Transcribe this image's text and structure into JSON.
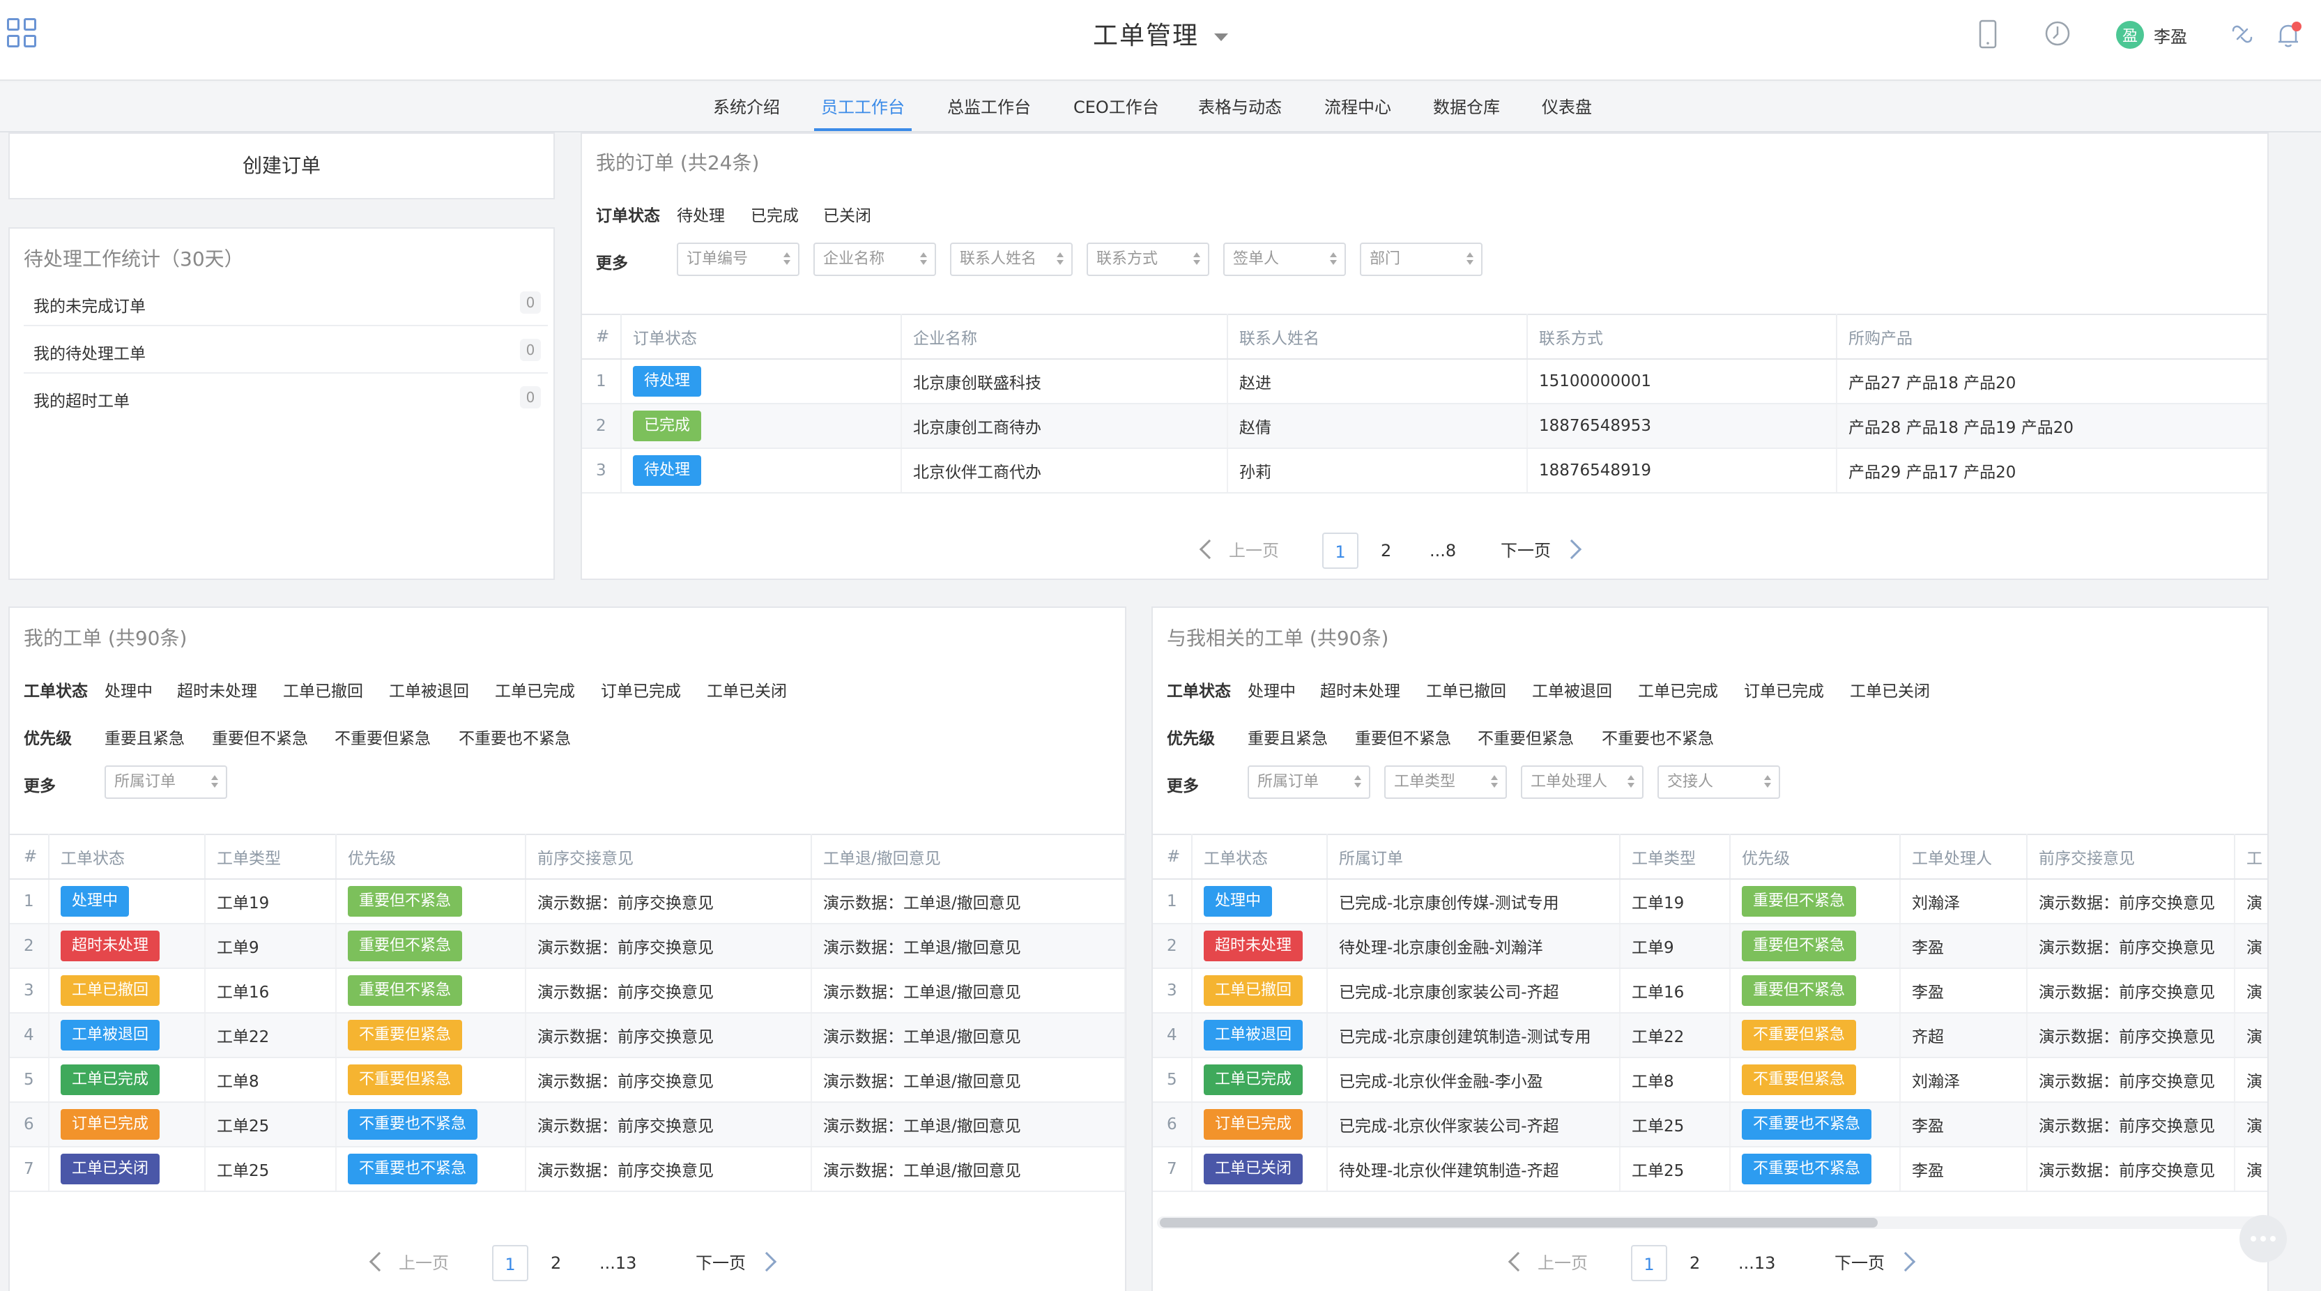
{
  "header": {
    "title": "工单管理",
    "user_name": "李盈",
    "user_initial": "盈",
    "icons": [
      "apps-grid-icon",
      "mobile-icon",
      "clock-icon",
      "link-icon",
      "bell-icon"
    ]
  },
  "nav": {
    "tabs": [
      {
        "label": "系统介绍"
      },
      {
        "label": "员工工作台",
        "active": true
      },
      {
        "label": "总监工作台"
      },
      {
        "label": "CEO工作台"
      },
      {
        "label": "表格与动态"
      },
      {
        "label": "流程中心"
      },
      {
        "label": "数据仓库"
      },
      {
        "label": "仪表盘"
      }
    ]
  },
  "create_order": {
    "label": "创建订单"
  },
  "pending_stats": {
    "title": "待处理工作统计（30天）",
    "rows": [
      {
        "label": "我的未完成订单",
        "count": "0"
      },
      {
        "label": "我的待处理工单",
        "count": "0"
      },
      {
        "label": "我的超时工单",
        "count": "0"
      }
    ]
  },
  "my_orders": {
    "title": "我的订单 (共24条)",
    "status_label": "订单状态",
    "status_options": [
      "待处理",
      "已完成",
      "已关闭"
    ],
    "more_label": "更多",
    "filters": [
      "订单编号",
      "企业名称",
      "联系人姓名",
      "联系方式",
      "签单人",
      "部门"
    ],
    "columns": [
      "#",
      "订单状态",
      "企业名称",
      "联系人姓名",
      "联系方式",
      "所购产品"
    ],
    "rows": [
      {
        "idx": "1",
        "status": "待处理",
        "status_color": "#2d9cf0",
        "company": "北京康创联盛科技",
        "contact": "赵进",
        "phone": "15100000001",
        "products": "产品27 产品18 产品20"
      },
      {
        "idx": "2",
        "status": "已完成",
        "status_color": "#7cc05b",
        "company": "北京康创工商待办",
        "contact": "赵倩",
        "phone": "18876548953",
        "products": "产品28 产品18 产品19 产品20"
      },
      {
        "idx": "3",
        "status": "待处理",
        "status_color": "#2d9cf0",
        "company": "北京伙伴工商代办",
        "contact": "孙莉",
        "phone": "18876548919",
        "products": "产品29 产品17 产品20"
      }
    ],
    "pager": {
      "prev": "上一页",
      "pages": [
        "1",
        "2",
        "...8"
      ],
      "current": "1",
      "next": "下一页"
    }
  },
  "my_tickets": {
    "title": "我的工单 (共90条)",
    "status_label": "工单状态",
    "status_options": [
      "处理中",
      "超时未处理",
      "工单已撤回",
      "工单被退回",
      "工单已完成",
      "订单已完成",
      "工单已关闭"
    ],
    "priority_label": "优先级",
    "priority_options": [
      "重要且紧急",
      "重要但不紧急",
      "不重要但紧急",
      "不重要也不紧急"
    ],
    "more_label": "更多",
    "filters": [
      "所属订单"
    ],
    "columns": [
      "#",
      "工单状态",
      "工单类型",
      "优先级",
      "前序交接意见",
      "工单退/撤回意见"
    ],
    "rows": [
      {
        "idx": "1",
        "status": "处理中",
        "status_color": "#2d9cf0",
        "type": "工单19",
        "priority": "重要但不紧急",
        "priority_color": "#7cc05b",
        "handover": "演示数据：前序交换意见",
        "back": "演示数据：工单退/撤回意见"
      },
      {
        "idx": "2",
        "status": "超时未处理",
        "status_color": "#e5474b",
        "type": "工单9",
        "priority": "重要但不紧急",
        "priority_color": "#7cc05b",
        "handover": "演示数据：前序交换意见",
        "back": "演示数据：工单退/撤回意见"
      },
      {
        "idx": "3",
        "status": "工单已撤回",
        "status_color": "#f5b431",
        "type": "工单16",
        "priority": "重要但不紧急",
        "priority_color": "#7cc05b",
        "handover": "演示数据：前序交换意见",
        "back": "演示数据：工单退/撤回意见"
      },
      {
        "idx": "4",
        "status": "工单被退回",
        "status_color": "#2d9cf0",
        "type": "工单22",
        "priority": "不重要但紧急",
        "priority_color": "#f5b431",
        "handover": "演示数据：前序交换意见",
        "back": "演示数据：工单退/撤回意见"
      },
      {
        "idx": "5",
        "status": "工单已完成",
        "status_color": "#3fa95b",
        "type": "工单8",
        "priority": "不重要但紧急",
        "priority_color": "#f5b431",
        "handover": "演示数据：前序交换意见",
        "back": "演示数据：工单退/撤回意见"
      },
      {
        "idx": "6",
        "status": "订单已完成",
        "status_color": "#f2932b",
        "type": "工单25",
        "priority": "不重要也不紧急",
        "priority_color": "#2d9cf0",
        "handover": "演示数据：前序交换意见",
        "back": "演示数据：工单退/撤回意见"
      },
      {
        "idx": "7",
        "status": "工单已关闭",
        "status_color": "#4a57a8",
        "type": "工单25",
        "priority": "不重要也不紧急",
        "priority_color": "#2d9cf0",
        "handover": "演示数据：前序交换意见",
        "back": "演示数据：工单退/撤回意见"
      }
    ],
    "pager": {
      "prev": "上一页",
      "pages": [
        "1",
        "2",
        "...13"
      ],
      "current": "1",
      "next": "下一页"
    }
  },
  "related_tickets": {
    "title": "与我相关的工单 (共90条)",
    "status_label": "工单状态",
    "status_options": [
      "处理中",
      "超时未处理",
      "工单已撤回",
      "工单被退回",
      "工单已完成",
      "订单已完成",
      "工单已关闭"
    ],
    "priority_label": "优先级",
    "priority_options": [
      "重要且紧急",
      "重要但不紧急",
      "不重要但紧急",
      "不重要也不紧急"
    ],
    "more_label": "更多",
    "filters": [
      "所属订单",
      "工单类型",
      "工单处理人",
      "交接人"
    ],
    "columns": [
      "#",
      "工单状态",
      "所属订单",
      "工单类型",
      "优先级",
      "工单处理人",
      "前序交接意见",
      "工"
    ],
    "rows": [
      {
        "idx": "1",
        "status": "处理中",
        "status_color": "#2d9cf0",
        "order": "已完成-北京康创传媒-测试专用",
        "type": "工单19",
        "priority": "重要但不紧急",
        "priority_color": "#7cc05b",
        "handler": "刘瀚泽",
        "handover": "演示数据：前序交换意见",
        "more": "演"
      },
      {
        "idx": "2",
        "status": "超时未处理",
        "status_color": "#e5474b",
        "order": "待处理-北京康创金融-刘瀚洋",
        "type": "工单9",
        "priority": "重要但不紧急",
        "priority_color": "#7cc05b",
        "handler": "李盈",
        "handover": "演示数据：前序交换意见",
        "more": "演"
      },
      {
        "idx": "3",
        "status": "工单已撤回",
        "status_color": "#f5b431",
        "order": "已完成-北京康创家装公司-齐超",
        "type": "工单16",
        "priority": "重要但不紧急",
        "priority_color": "#7cc05b",
        "handler": "李盈",
        "handover": "演示数据：前序交换意见",
        "more": "演"
      },
      {
        "idx": "4",
        "status": "工单被退回",
        "status_color": "#2d9cf0",
        "order": "已完成-北京康创建筑制造-测试专用",
        "type": "工单22",
        "priority": "不重要但紧急",
        "priority_color": "#f5b431",
        "handler": "齐超",
        "handover": "演示数据：前序交换意见",
        "more": "演"
      },
      {
        "idx": "5",
        "status": "工单已完成",
        "status_color": "#3fa95b",
        "order": "已完成-北京伙伴金融-李小盈",
        "type": "工单8",
        "priority": "不重要但紧急",
        "priority_color": "#f5b431",
        "handler": "刘瀚泽",
        "handover": "演示数据：前序交换意见",
        "more": "演"
      },
      {
        "idx": "6",
        "status": "订单已完成",
        "status_color": "#f2932b",
        "order": "已完成-北京伙伴家装公司-齐超",
        "type": "工单25",
        "priority": "不重要也不紧急",
        "priority_color": "#2d9cf0",
        "handler": "李盈",
        "handover": "演示数据：前序交换意见",
        "more": "演"
      },
      {
        "idx": "7",
        "status": "工单已关闭",
        "status_color": "#4a57a8",
        "order": "待处理-北京伙伴建筑制造-齐超",
        "type": "工单25",
        "priority": "不重要也不紧急",
        "priority_color": "#2d9cf0",
        "handler": "李盈",
        "handover": "演示数据：前序交换意见",
        "more": "演"
      }
    ],
    "pager": {
      "prev": "上一页",
      "pages": [
        "1",
        "2",
        "...13"
      ],
      "current": "1",
      "next": "下一页"
    }
  }
}
